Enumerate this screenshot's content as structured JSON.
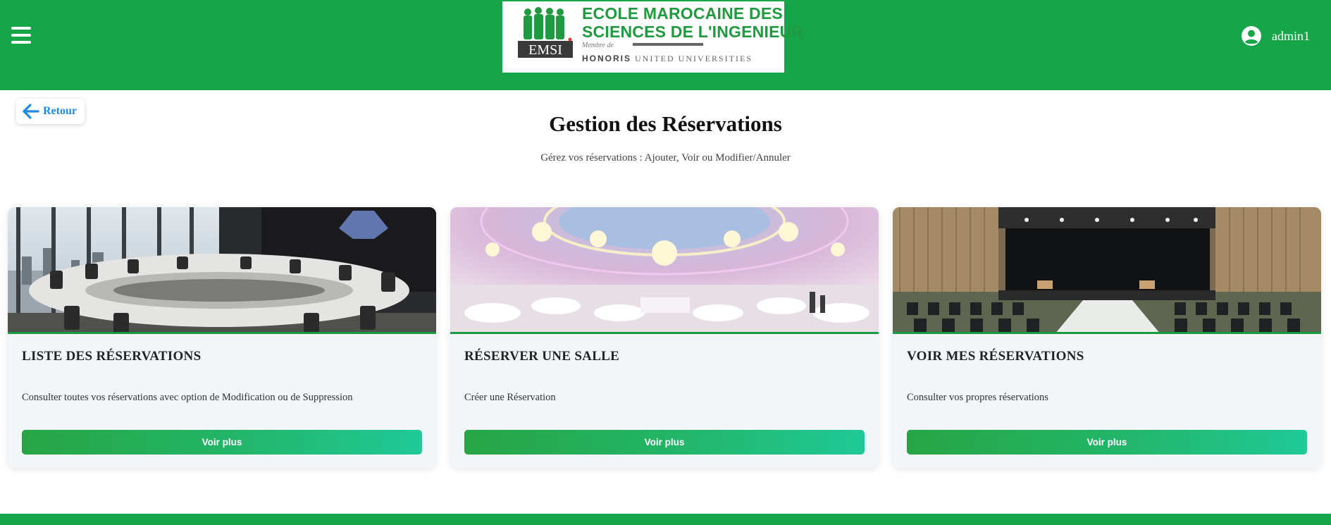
{
  "header": {
    "menu_icon": "hamburger-icon",
    "logo": {
      "line1": "ECOLE MAROCAINE DES",
      "line2": "SCIENCES DE L'INGENIEUR",
      "member": "Membre de",
      "honoris_bold": "HONORIS",
      "honoris_rest": " UNITED UNIVERSITIES",
      "emsi": "EMSI"
    },
    "user": {
      "icon": "user-circle-icon",
      "name": "admin1"
    },
    "color": "#17a54a"
  },
  "back": {
    "label": "Retour",
    "icon": "arrow-left-icon",
    "color": "#1e88e5"
  },
  "page": {
    "title": "Gestion des Réservations",
    "subtitle": "Gérez vos réservations : Ajouter, Voir ou Modifier/Annuler"
  },
  "cards": [
    {
      "title": "LISTE DES RÉSERVATIONS",
      "description": "Consulter toutes vos réservations avec option de Modification ou de Suppression",
      "button": "Voir plus"
    },
    {
      "title": "RÉSERVER UNE SALLE",
      "description": "Créer une Réservation",
      "button": "Voir plus"
    },
    {
      "title": "VOIR MES RÉSERVATIONS",
      "description": "Consulter vos propres réservations",
      "button": "Voir plus"
    }
  ],
  "accent_colors": {
    "green": "#17a54a",
    "button_start": "#27a544",
    "button_end": "#20c997"
  }
}
